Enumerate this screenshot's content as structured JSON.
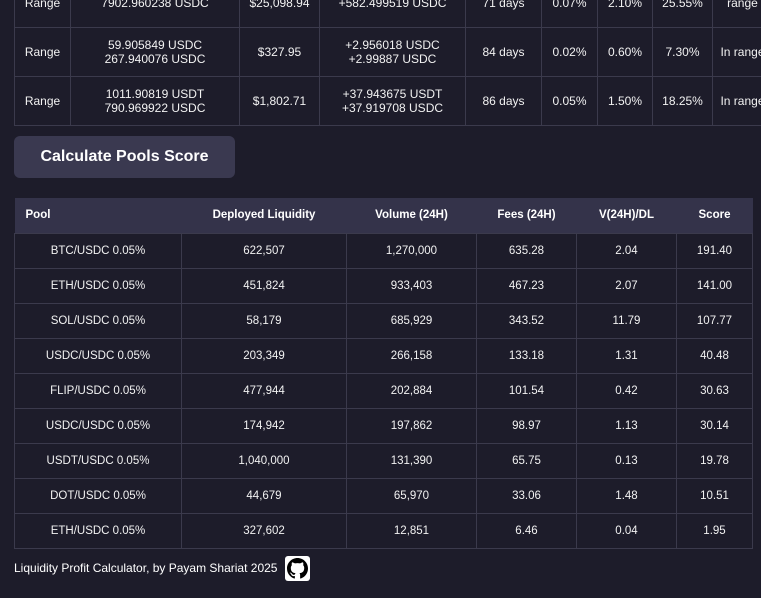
{
  "positions": {
    "rows": [
      {
        "type": "Range",
        "amounts": [
          "",
          "7902.960238 USDC"
        ],
        "value": "$25,098.94",
        "fees": [
          "",
          "+582.499519 USDC"
        ],
        "age": "71 days",
        "pct1": "0.07%",
        "pct2": "2.10%",
        "pct3": "25.55%",
        "status": "range"
      },
      {
        "type": "Range",
        "amounts": [
          "59.905849 USDC",
          "267.940076 USDC"
        ],
        "value": "$327.95",
        "fees": [
          "+2.956018 USDC",
          "+2.99887 USDC"
        ],
        "age": "84 days",
        "pct1": "0.02%",
        "pct2": "0.60%",
        "pct3": "7.30%",
        "status": "In range"
      },
      {
        "type": "Range",
        "amounts": [
          "1011.90819 USDT",
          "790.969922 USDC"
        ],
        "value": "$1,802.71",
        "fees": [
          "+37.943675 USDT",
          "+37.919708 USDC"
        ],
        "age": "86 days",
        "pct1": "0.05%",
        "pct2": "1.50%",
        "pct3": "18.25%",
        "status": "In range"
      }
    ]
  },
  "calculate_button": {
    "label": "Calculate Pools Score"
  },
  "pools": {
    "headers": [
      "Pool",
      "Deployed Liquidity",
      "Volume (24H)",
      "Fees (24H)",
      "V(24H)/DL",
      "Score"
    ],
    "rows": [
      [
        "BTC/USDC 0.05%",
        "622,507",
        "1,270,000",
        "635.28",
        "2.04",
        "191.40"
      ],
      [
        "ETH/USDC 0.05%",
        "451,824",
        "933,403",
        "467.23",
        "2.07",
        "141.00"
      ],
      [
        "SOL/USDC 0.05%",
        "58,179",
        "685,929",
        "343.52",
        "11.79",
        "107.77"
      ],
      [
        "USDC/USDC 0.05%",
        "203,349",
        "266,158",
        "133.18",
        "1.31",
        "40.48"
      ],
      [
        "FLIP/USDC 0.05%",
        "477,944",
        "202,884",
        "101.54",
        "0.42",
        "30.63"
      ],
      [
        "USDC/USDC 0.05%",
        "174,942",
        "197,862",
        "98.97",
        "1.13",
        "30.14"
      ],
      [
        "USDT/USDC 0.05%",
        "1,040,000",
        "131,390",
        "65.75",
        "0.13",
        "19.78"
      ],
      [
        "DOT/USDC 0.05%",
        "44,679",
        "65,970",
        "33.06",
        "1.48",
        "10.51"
      ],
      [
        "ETH/USDC 0.05%",
        "327,602",
        "12,851",
        "6.46",
        "0.04",
        "1.95"
      ]
    ]
  },
  "footer": {
    "text": "Liquidity Profit Calculator, by Payam Shariat 2025",
    "icon": "github-icon"
  },
  "colors": {
    "background": "#1d1c2a",
    "header_bg": "#34334a",
    "button_bg": "#3a3950",
    "border": "#3b3a4c"
  }
}
